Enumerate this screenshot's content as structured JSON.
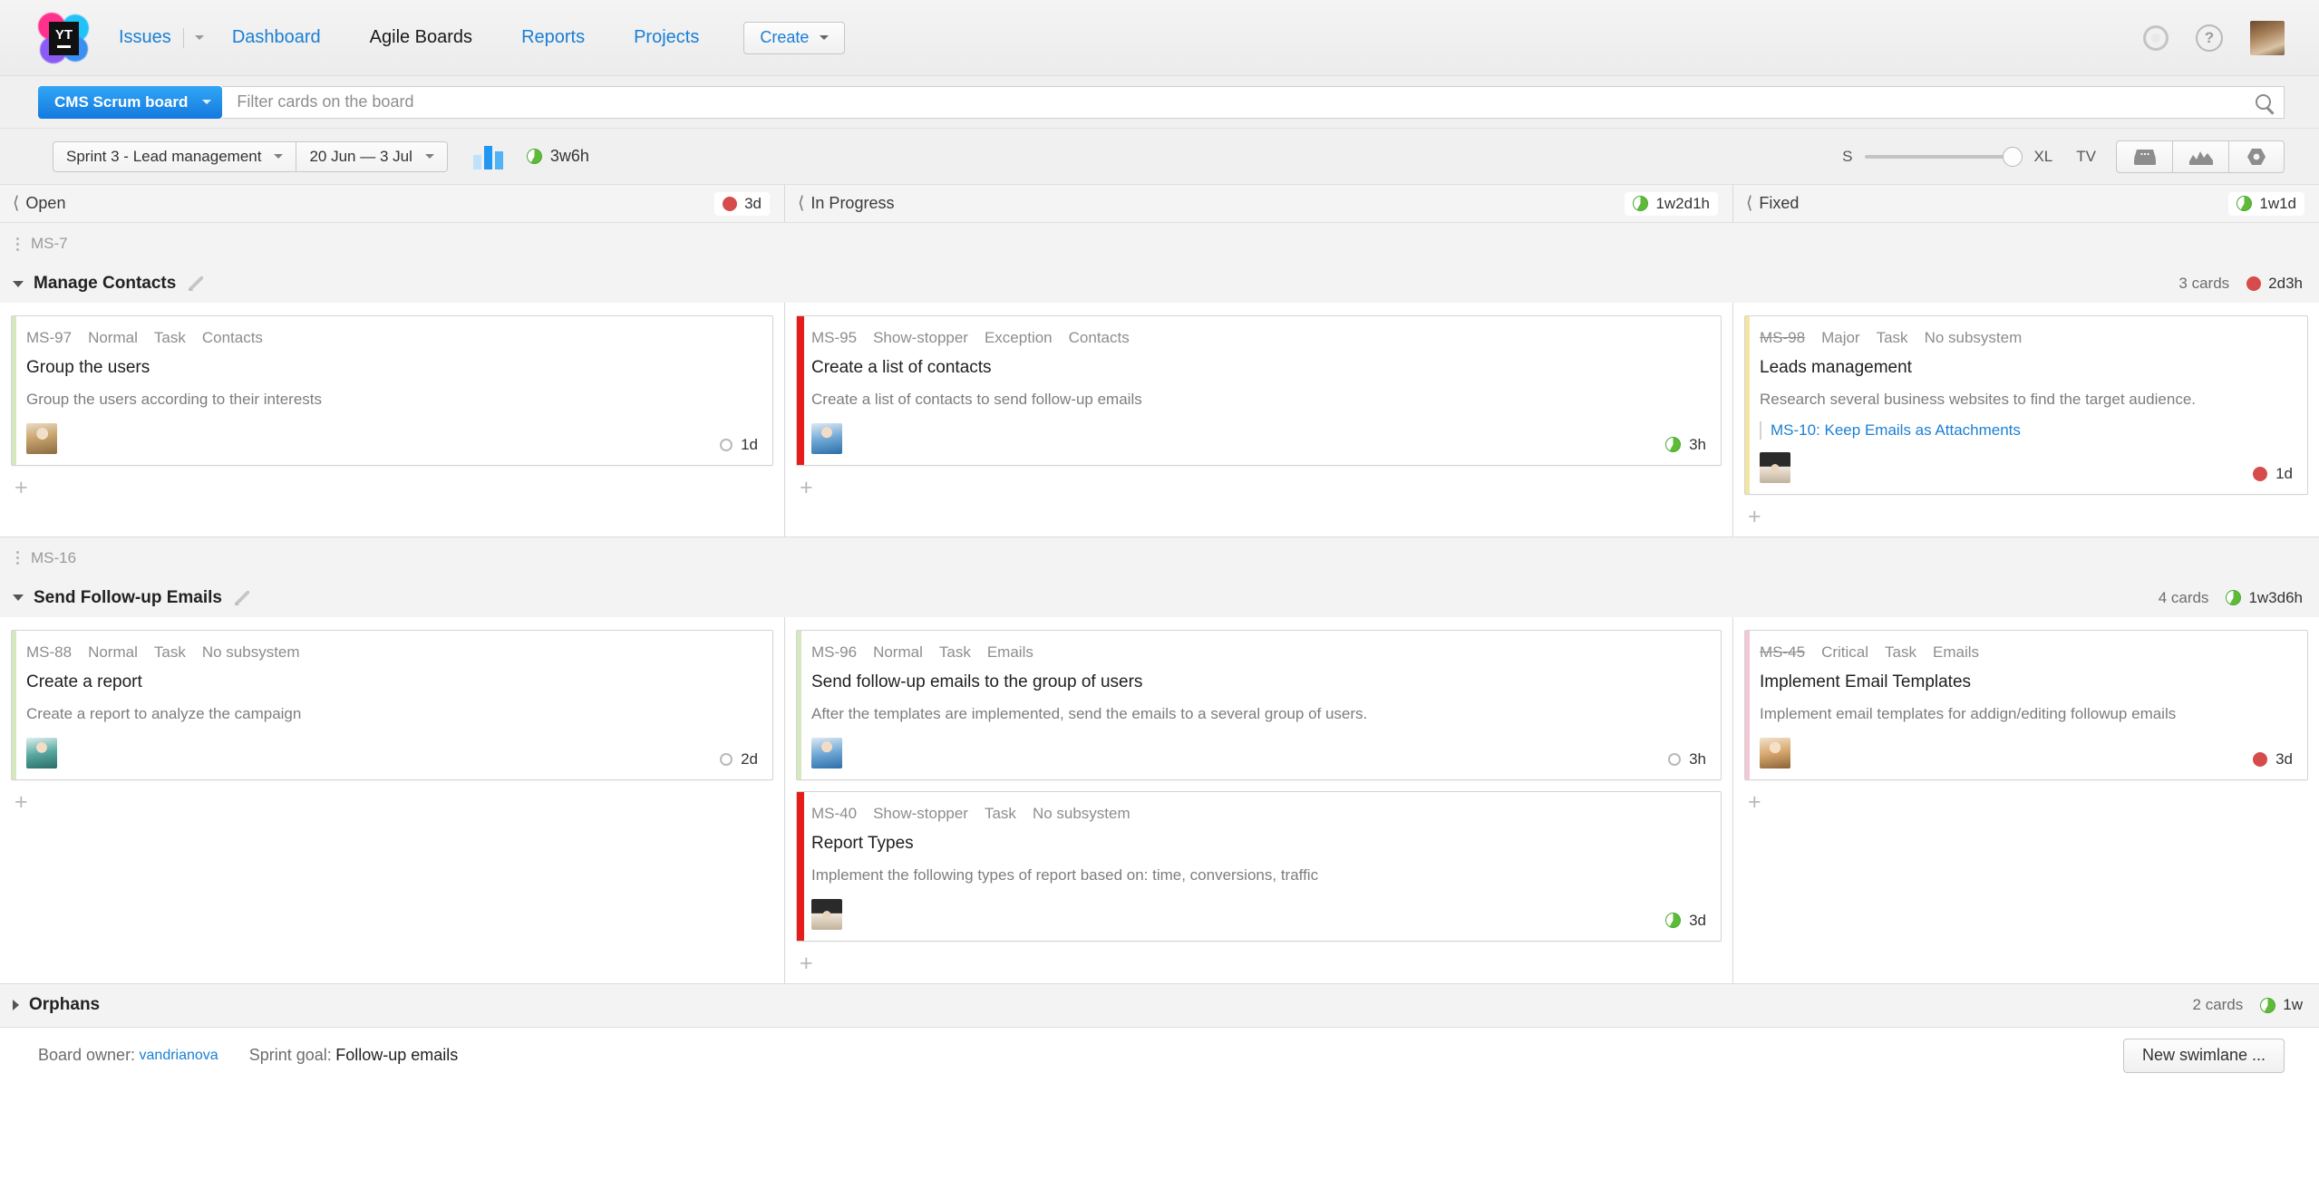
{
  "nav": {
    "logo_text": "YT",
    "issues": "Issues",
    "dashboard": "Dashboard",
    "agile_boards": "Agile Boards",
    "reports": "Reports",
    "projects": "Projects",
    "create": "Create",
    "help_icon": "?"
  },
  "filter": {
    "board_name": "CMS Scrum board",
    "placeholder": "Filter cards on the board",
    "value": ""
  },
  "sprint": {
    "name": "Sprint 3 - Lead management",
    "dates": "20 Jun — 3 Jul",
    "estimation": "3w6h",
    "size_min": "S",
    "size_max": "XL",
    "tv_mode": "TV"
  },
  "columns": [
    {
      "title": "Open",
      "badge": "3d",
      "badge_type": "red"
    },
    {
      "title": "In Progress",
      "badge": "1w2d1h",
      "badge_type": "pie"
    },
    {
      "title": "Fixed",
      "badge": "1w1d",
      "badge_type": "pie"
    }
  ],
  "swimlanes": [
    {
      "id": "MS-7",
      "title": "Manage Contacts",
      "cards_count": "3 cards",
      "estimate": "2d3h",
      "estimate_type": "red",
      "cells": [
        {
          "cards": [
            {
              "id": "MS-97",
              "resolved": false,
              "priority": "Normal",
              "type": "Task",
              "subsystem": "Contacts",
              "title": "Group the users",
              "description": "Group the users according to their interests",
              "link": null,
              "avatar": "av-blonde",
              "estimate": "1d",
              "estimate_type": "open",
              "stripe": "#d6e8c0",
              "wide": false
            }
          ]
        },
        {
          "cards": [
            {
              "id": "MS-95",
              "resolved": false,
              "priority": "Show-stopper",
              "type": "Exception",
              "subsystem": "Contacts",
              "title": "Create a list of contacts",
              "description": "Create a list of contacts to send follow-up emails",
              "link": null,
              "avatar": "av-blue",
              "estimate": "3h",
              "estimate_type": "pie",
              "stripe": "#e81b1b",
              "wide": true
            }
          ]
        },
        {
          "cards": [
            {
              "id": "MS-98",
              "resolved": true,
              "priority": "Major",
              "type": "Task",
              "subsystem": "No subsystem",
              "title": "Leads management",
              "description": "Research several business websites to find the target audience.",
              "link": "MS-10: Keep Emails as Attachments",
              "avatar": "av-hat",
              "estimate": "1d",
              "estimate_type": "red",
              "stripe": "#f2e6a0",
              "wide": false
            }
          ]
        }
      ]
    },
    {
      "id": "MS-16",
      "title": "Send Follow-up Emails",
      "cards_count": "4 cards",
      "estimate": "1w3d6h",
      "estimate_type": "pie",
      "cells": [
        {
          "cards": [
            {
              "id": "MS-88",
              "resolved": false,
              "priority": "Normal",
              "type": "Task",
              "subsystem": "No subsystem",
              "title": "Create a report",
              "description": "Create a report to analyze the campaign",
              "link": null,
              "avatar": "av-teal",
              "estimate": "2d",
              "estimate_type": "open",
              "stripe": "#d6e8c0",
              "wide": false
            }
          ]
        },
        {
          "cards": [
            {
              "id": "MS-96",
              "resolved": false,
              "priority": "Normal",
              "type": "Task",
              "subsystem": "Emails",
              "title": "Send follow-up emails to the group of users",
              "description": "After the templates are implemented, send the emails to a several group of users.",
              "link": null,
              "avatar": "av-blue",
              "estimate": "3h",
              "estimate_type": "open",
              "stripe": "#d6e8c0",
              "wide": false
            },
            {
              "id": "MS-40",
              "resolved": false,
              "priority": "Show-stopper",
              "type": "Task",
              "subsystem": "No subsystem",
              "title": "Report Types",
              "description": "Implement the following types of report based on: time, conversions, traffic",
              "link": null,
              "avatar": "av-hat",
              "estimate": "3d",
              "estimate_type": "pie",
              "stripe": "#e81b1b",
              "wide": true
            }
          ]
        },
        {
          "cards": [
            {
              "id": "MS-45",
              "resolved": true,
              "priority": "Critical",
              "type": "Task",
              "subsystem": "Emails",
              "title": "Implement Email Templates",
              "description": "Implement email templates for addign/editing followup emails",
              "link": null,
              "avatar": "av-girl",
              "estimate": "3d",
              "estimate_type": "red",
              "stripe": "#f3c7d3",
              "wide": false
            }
          ]
        }
      ]
    }
  ],
  "orphans": {
    "title": "Orphans",
    "cards_count": "2 cards",
    "estimate": "1w",
    "estimate_type": "pie"
  },
  "footer": {
    "owner_label": "Board owner:",
    "owner_name": "vandrianova",
    "goal_label": "Sprint goal:",
    "goal_value": "Follow-up emails",
    "new_swimlane": "New swimlane ..."
  },
  "colors": {
    "accent": "#1a7fd4",
    "board_blue": "#1479e0",
    "red": "#d64c4c",
    "green": "#5dbb37"
  }
}
